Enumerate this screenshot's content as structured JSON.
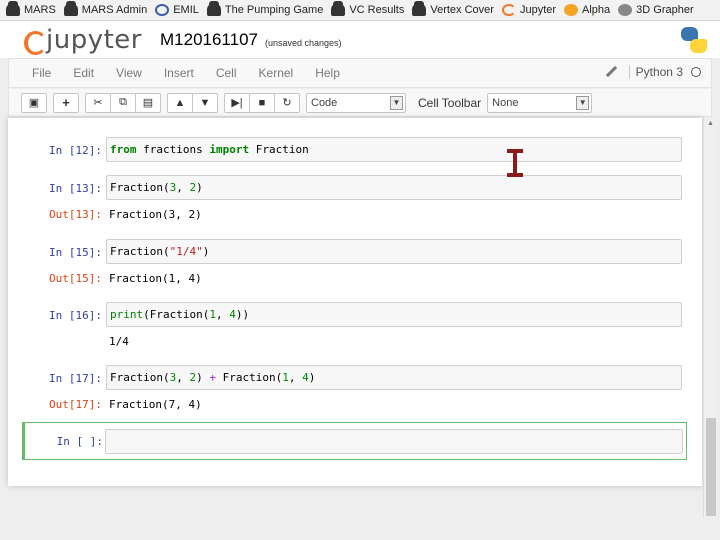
{
  "bookmarks": [
    {
      "label": "MARS",
      "icon": "car-icon"
    },
    {
      "label": "MARS Admin",
      "icon": "car-icon"
    },
    {
      "label": "EMIL",
      "icon": "emil-icon"
    },
    {
      "label": "The Pumping Game",
      "icon": "car-icon"
    },
    {
      "label": "VC Results",
      "icon": "car-icon"
    },
    {
      "label": "Vertex Cover",
      "icon": "car-icon"
    },
    {
      "label": "Jupyter",
      "icon": "jupyter-icon"
    },
    {
      "label": "Alpha",
      "icon": "alpha-icon"
    },
    {
      "label": "3D Grapher",
      "icon": "grapher-icon"
    }
  ],
  "header": {
    "logo_text": "jupyter",
    "notebook_name": "M120161107",
    "save_status": "(unsaved changes)"
  },
  "menubar": {
    "items": [
      "File",
      "Edit",
      "View",
      "Insert",
      "Cell",
      "Kernel",
      "Help"
    ],
    "kernel_name": "Python 3"
  },
  "toolbar": {
    "cell_type": "Code",
    "cell_toolbar_label": "Cell Toolbar",
    "cell_toolbar_value": "None"
  },
  "cells": [
    {
      "in_prompt": "In [12]:",
      "code": "from fractions import Fraction",
      "out_prompt": "",
      "output": ""
    },
    {
      "in_prompt": "In [13]:",
      "code": "Fraction(3, 2)",
      "out_prompt": "Out[13]:",
      "output": "Fraction(3, 2)"
    },
    {
      "in_prompt": "In [15]:",
      "code": "Fraction(\"1/4\")",
      "out_prompt": "Out[15]:",
      "output": "Fraction(1, 4)"
    },
    {
      "in_prompt": "In [16]:",
      "code": "print(Fraction(1, 4))",
      "out_prompt": "",
      "output": "1/4"
    },
    {
      "in_prompt": "In [17]:",
      "code": "Fraction(3, 2) + Fraction(1, 4)",
      "out_prompt": "Out[17]:",
      "output": "Fraction(7, 4)"
    }
  ],
  "active_cell": {
    "in_prompt": "In [ ]:",
    "code": ""
  }
}
